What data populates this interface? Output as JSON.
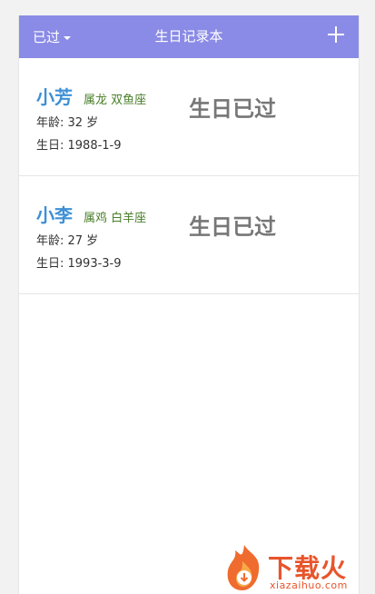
{
  "header": {
    "filter_label": "已过",
    "title": "生日记录本",
    "add_icon": "plus-icon"
  },
  "records": [
    {
      "name": "小芳",
      "tags": "属龙 双鱼座",
      "age": "年龄: 32 岁",
      "birthday": "生日: 1988-1-9",
      "status": "生日已过"
    },
    {
      "name": "小李",
      "tags": "属鸡 白羊座",
      "age": "年龄: 27 岁",
      "birthday": "生日: 1993-3-9",
      "status": "生日已过"
    }
  ],
  "watermark": {
    "brand": "下载火",
    "url": "xiazaihuo.com"
  },
  "colors": {
    "header_bg": "#8a8be6",
    "name": "#3d8fd6",
    "tags": "#4a7f2a",
    "status": "#777777",
    "watermark": "#e8542b"
  }
}
